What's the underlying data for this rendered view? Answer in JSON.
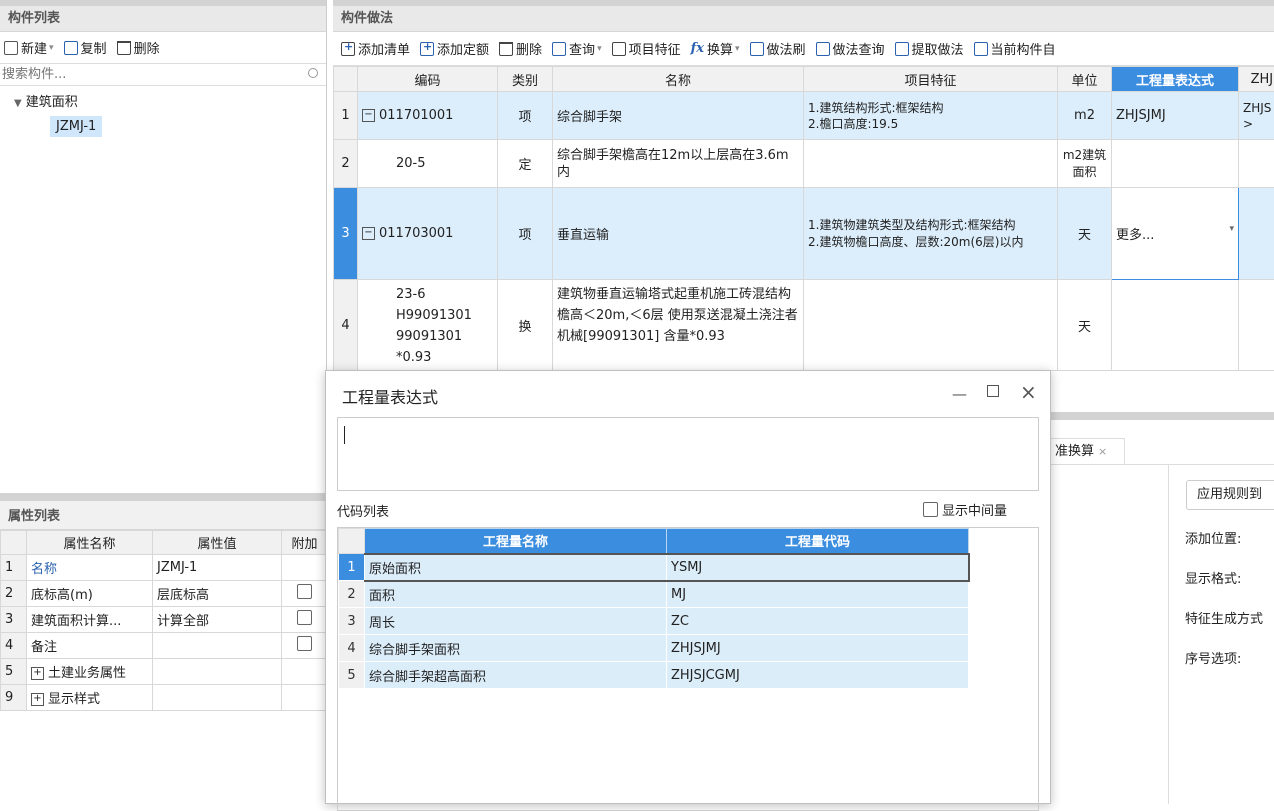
{
  "left_panel": {
    "title": "构件列表",
    "toolbar": {
      "new_label": "新建",
      "copy_label": "复制",
      "delete_label": "删除"
    },
    "search_placeholder": "搜索构件...",
    "tree": {
      "root": "建筑面积",
      "child": "JZMJ-1"
    }
  },
  "props_panel": {
    "title": "属性列表",
    "headers": [
      "属性名称",
      "属性值",
      "附加"
    ],
    "rows": [
      {
        "num": "1",
        "name": "名称",
        "value": "JZMJ-1",
        "check": false
      },
      {
        "num": "2",
        "name": "底标高(m)",
        "value": "层底标高",
        "check": true
      },
      {
        "num": "3",
        "name": "建筑面积计算...",
        "value": "计算全部",
        "check": true
      },
      {
        "num": "4",
        "name": "备注",
        "value": "",
        "check": true
      },
      {
        "num": "5",
        "name": "土建业务属性",
        "value": "",
        "check": false
      },
      {
        "num": "9",
        "name": "显示样式",
        "value": "",
        "check": false
      }
    ]
  },
  "main_panel": {
    "title": "构件做法",
    "toolbar": {
      "add_list": "添加清单",
      "add_quota": "添加定额",
      "delete": "删除",
      "query": "查询",
      "item_feature": "项目特征",
      "convert": "换算",
      "method_brush": "做法刷",
      "method_query": "做法查询",
      "extract_method": "提取做法",
      "current_component": "当前构件自"
    },
    "headers": [
      "编码",
      "类别",
      "名称",
      "项目特征",
      "单位",
      "工程量表达式",
      "ZHJS"
    ],
    "rows": [
      {
        "num": "1",
        "code": "011701001",
        "type": "项",
        "name": "综合脚手架",
        "feature": "1.建筑结构形式:框架结构\n2.檐口高度:19.5",
        "unit": "m2",
        "expr": "ZHJSJMJ",
        "extra": "ZHJS\n>"
      },
      {
        "num": "2",
        "code": "20-5",
        "type": "定",
        "name": "综合脚手架檐高在12m以上层高在3.6m内",
        "feature": "",
        "unit": "m2建筑面积",
        "expr": "",
        "extra": ""
      },
      {
        "num": "3",
        "code": "011703001",
        "type": "项",
        "name": "垂直运输",
        "feature": "1.建筑物建筑类型及结构形式:框架结构\n2.建筑物檐口高度、层数:20m(6层)以内",
        "unit": "天",
        "expr": "更多...",
        "extra": ""
      },
      {
        "num": "4",
        "code": "23-6\nH99091301\n99091301\n*0.93",
        "type": "换",
        "name": "建筑物垂直运输塔式起重机施工砖混结构檐高＜20m,＜6层 使用泵送混凝土浇注者 机械[99091301] 含量*0.93",
        "feature": "",
        "unit": "天",
        "expr": "",
        "extra": ""
      }
    ]
  },
  "right_lower": {
    "tab_label": "准换算",
    "apply_button": "应用规则到",
    "labels": [
      "添加位置:",
      "显示格式:",
      "特征生成方式",
      "序号选项:"
    ]
  },
  "dialog": {
    "title": "工程量表达式",
    "code_list_label": "代码列表",
    "show_intermediate_label": "显示中间量",
    "headers": [
      "工程量名称",
      "工程量代码"
    ],
    "rows": [
      {
        "num": "1",
        "name": "原始面积",
        "code": "YSMJ"
      },
      {
        "num": "2",
        "name": "面积",
        "code": "MJ"
      },
      {
        "num": "3",
        "name": "周长",
        "code": "ZC"
      },
      {
        "num": "4",
        "name": "综合脚手架面积",
        "code": "ZHJSJMJ"
      },
      {
        "num": "5",
        "name": "综合脚手架超高面积",
        "code": "ZHJSJCGMJ"
      }
    ]
  }
}
